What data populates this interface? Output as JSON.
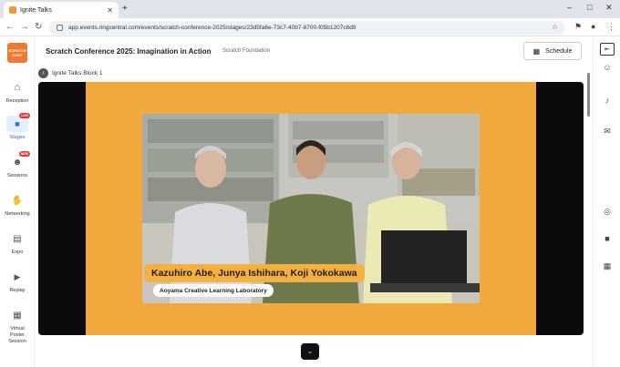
{
  "browser": {
    "tab_title": "Ignite Talks",
    "url": "app.events.ringcentral.com/events/scratch-conference-2025/stages/23d5fa6e-73c7-40b7-8700-f05b1207c6d9",
    "window_controls": [
      "–",
      "□",
      "✕"
    ]
  },
  "sidebar": {
    "logo_text": "SCRATCH CONF",
    "items": [
      {
        "label": "Reception",
        "icon": "home-icon",
        "glyph": "⌂"
      },
      {
        "label": "Stages",
        "icon": "video-camera-icon",
        "glyph": "■",
        "badge": "LIVE"
      },
      {
        "label": "Sessions",
        "icon": "people-icon",
        "glyph": "☻",
        "badge": "NEW"
      },
      {
        "label": "Networking",
        "icon": "handshake-icon",
        "glyph": "✋"
      },
      {
        "label": "Expo",
        "icon": "storefront-icon",
        "glyph": "▤"
      },
      {
        "label": "Replay",
        "icon": "play-circle-icon",
        "glyph": "▶"
      },
      {
        "label": "Virtual Poster Session",
        "icon": "poster-icon",
        "glyph": "▦"
      }
    ]
  },
  "header": {
    "event_title": "Scratch Conference 2025: Imagination in Action",
    "organizer": "Scratch Foundation",
    "schedule_label": "Schedule"
  },
  "breadcrumb": {
    "label": "Ignite Talks Block 1"
  },
  "video": {
    "speakers_caption": "Kazuhiro Abe, Junya Ishihara, Koji Yokokawa",
    "affiliation_caption": "Aoyama Creative Learning Laboratory"
  },
  "colors": {
    "accent_orange": "#f1a83c",
    "brand_logo": "#f0792f",
    "active_nav": "#2b6de0",
    "live_badge": "#e53935"
  }
}
